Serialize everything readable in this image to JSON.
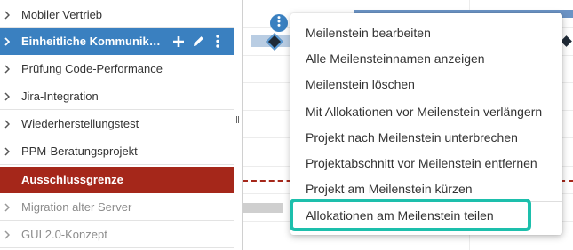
{
  "sidebar": {
    "rows": [
      {
        "label": "Mobiler Vertrieb"
      },
      {
        "label": "Einheitliche Kommunikationsplattform"
      },
      {
        "label": "Prüfung Code-Performance"
      },
      {
        "label": "Jira-Integration"
      },
      {
        "label": "Wiederherstellungstest"
      },
      {
        "label": "PPM-Beratungsprojekt"
      },
      {
        "label": "Ausschlussgrenze"
      },
      {
        "label": "Migration alter Server"
      },
      {
        "label": "GUI 2.0-Konzept"
      }
    ],
    "selected_index": 1,
    "actions": {
      "add_icon": "plus-icon",
      "edit_icon": "pencil-icon",
      "more_icon": "more-vertical-icon"
    }
  },
  "gantt": {
    "milestone_menu_icon": "more-vertical-icon"
  },
  "context_menu": {
    "items": [
      "Meilenstein bearbeiten",
      "Alle Meilensteinnamen anzeigen",
      "Meilenstein löschen",
      "Mit Allokationen vor Meilenstein verlängern",
      "Projekt nach Meilenstein unterbrechen",
      "Projektabschnitt vor Meilenstein entfernen",
      "Projekt am Meilenstein kürzen",
      "Allokationen am Meilenstein teilen"
    ],
    "highlighted_item": "Allokationen am Meilenstein teilen"
  },
  "colors": {
    "selected_row": "#3a80c0",
    "deadline_row": "#a5271a",
    "highlight_border": "#1dbfac",
    "bar_blue": "#6b93c5",
    "milestone": "#1f2a36"
  }
}
